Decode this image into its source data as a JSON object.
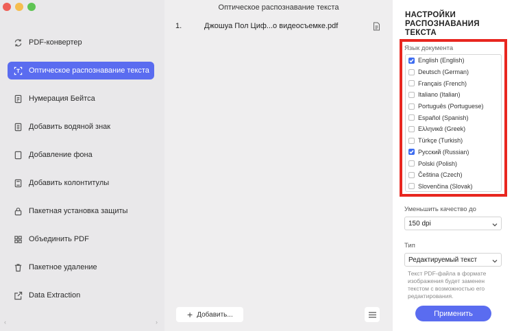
{
  "sidebar": {
    "items": [
      {
        "label": "PDF-конвертер",
        "icon": "refresh-icon",
        "active": false
      },
      {
        "label": "Оптическое распознавание текста",
        "icon": "ocr-scan-icon",
        "active": true
      },
      {
        "label": "Нумерация Бейтса",
        "icon": "bates-numbering-icon",
        "active": false
      },
      {
        "label": "Добавить водяной знак",
        "icon": "watermark-icon",
        "active": false
      },
      {
        "label": "Добавление фона",
        "icon": "background-icon",
        "active": false
      },
      {
        "label": "Добавить колонтитулы",
        "icon": "header-footer-icon",
        "active": false
      },
      {
        "label": "Пакетная установка защиты",
        "icon": "lock-icon",
        "active": false
      },
      {
        "label": "Объединить PDF",
        "icon": "merge-icon",
        "active": false
      },
      {
        "label": "Пакетное удаление",
        "icon": "trash-icon",
        "active": false
      },
      {
        "label": "Data Extraction",
        "icon": "export-icon",
        "active": false
      }
    ]
  },
  "main": {
    "title": "Оптическое распознавание текста",
    "files": [
      {
        "num": "1.",
        "name": "Джошуа Пол Циф...о видеосъемке.pdf"
      }
    ],
    "add_label": "Добавить..."
  },
  "panel": {
    "title": "НАСТРОЙКИ РАСПОЗНАВАНИЯ ТЕКСТА",
    "lang_label": "Язык документа",
    "languages": [
      {
        "label": "English (English)",
        "checked": true
      },
      {
        "label": "Deutsch (German)",
        "checked": false
      },
      {
        "label": "Français (French)",
        "checked": false
      },
      {
        "label": "Italiano (Italian)",
        "checked": false
      },
      {
        "label": "Português (Portuguese)",
        "checked": false
      },
      {
        "label": "Español (Spanish)",
        "checked": false
      },
      {
        "label": "Ελληνικά (Greek)",
        "checked": false
      },
      {
        "label": "Türkçe (Turkish)",
        "checked": false
      },
      {
        "label": "Русский (Russian)",
        "checked": true
      },
      {
        "label": "Polski (Polish)",
        "checked": false
      },
      {
        "label": "Čeština (Czech)",
        "checked": false
      },
      {
        "label": "Slovenčina (Slovak)",
        "checked": false
      }
    ],
    "quality_label": "Уменьшить качество до",
    "quality_value": "150 dpi",
    "type_label": "Тип",
    "type_value": "Редактируемый текст",
    "description": "Текст PDF-файла в формате изображения будет заменен текстом с возможностью его редактирования.",
    "apply_label": "Применить"
  },
  "colors": {
    "accent": "#5a6cf0",
    "highlight": "#e8261f",
    "sidebar_bg": "#e9e8ea"
  }
}
